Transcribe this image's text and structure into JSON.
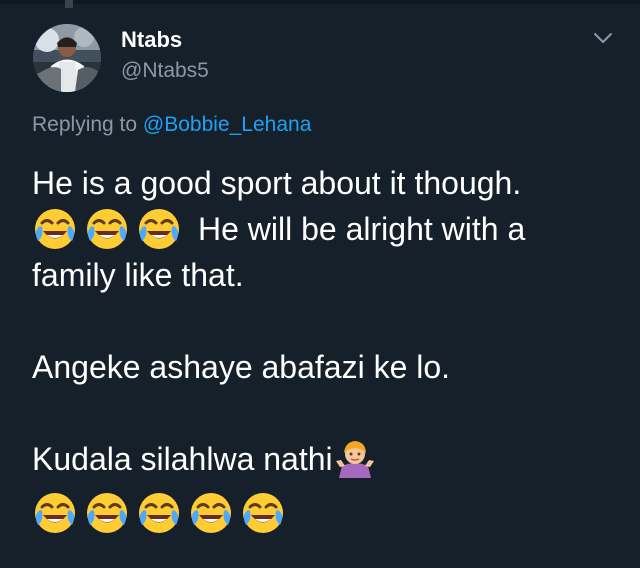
{
  "author": {
    "name": "Ntabs",
    "handle": "@Ntabs5"
  },
  "reply": {
    "prefix": "Replying to",
    "target": "@Bobbie_Lehana"
  },
  "tweet": {
    "line1": "He is a good sport about it though.",
    "line2": "He will be alright with a",
    "line3": "family like that.",
    "line4": "Angeke ashaye abafazi ke lo.",
    "line5": "Kudala silahlwa nathi"
  },
  "icons": {
    "menu": "chevron-down-icon",
    "laugh": "tears-of-joy-emoji",
    "shrug": "person-shrugging-emoji"
  },
  "colors": {
    "background": "#15202b",
    "link": "#1da1f2",
    "secondary_text": "#8899a6"
  }
}
